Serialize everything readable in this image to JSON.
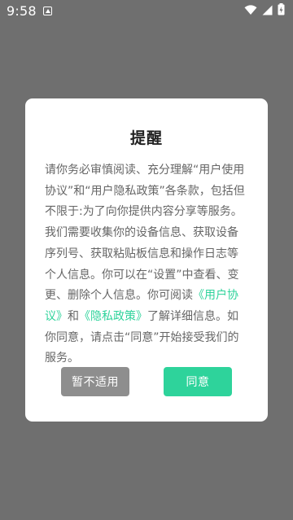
{
  "status_bar": {
    "time": "9:58",
    "notification_icon": "notification-icon",
    "icons": [
      "wifi-icon",
      "signal-icon",
      "battery-icon"
    ]
  },
  "dialog": {
    "title": "提醒",
    "body_before": "请你务必审慎阅读、充分理解“用户使用协议”和“用户隐私政策”各条款，包括但不限于:为了向你提供内容分享等服务。我们需要收集你的设备信息、获取设备序列号、获取粘贴板信息和操作日志等个人信息。你可以在“设置”中查看、变更、删除个人信息。你可阅读",
    "link_user_agreement": "《用户协议》",
    "and_text": "和",
    "link_privacy_policy": "《隐私政策》",
    "body_after": "了解详细信息。如你同意，请点击“同意”开始接受我们的服务。",
    "decline_label": "暂不适用",
    "agree_label": "同意"
  },
  "colors": {
    "overlay": "#6f6f6f",
    "accent": "#2ed39b",
    "decline": "#8e8e8e"
  }
}
